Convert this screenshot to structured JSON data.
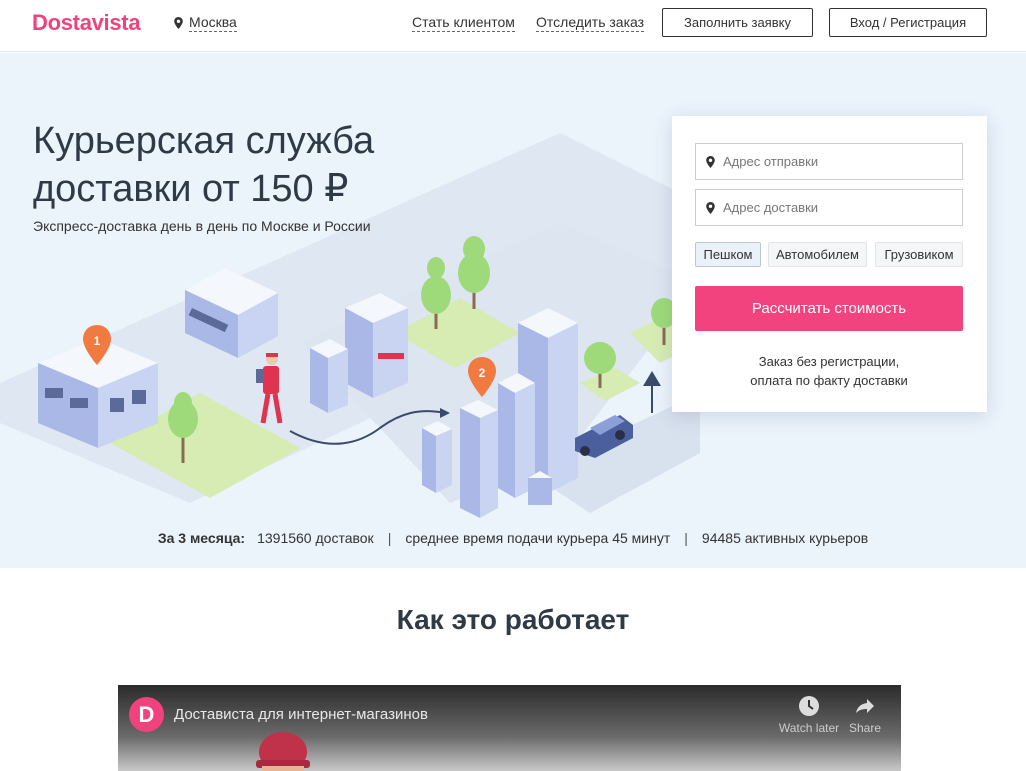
{
  "header": {
    "logo": "Dostavista",
    "city": "Москва",
    "nav": [
      "Стать клиентом",
      "Отследить заказ"
    ],
    "order_button": "Заполнить заявку",
    "login_button": "Вход / Регистрация"
  },
  "hero": {
    "title": "Курьерская служба доставки от 150 ₽",
    "subtitle": "Экспресс-доставка день в день по Москве и России",
    "markers": [
      "1",
      "2"
    ]
  },
  "form": {
    "from_placeholder": "Адрес отправки",
    "to_placeholder": "Адрес доставки",
    "transport": [
      "Пешком",
      "Автомобилем",
      "Грузовиком"
    ],
    "selected_transport": "Пешком",
    "submit": "Рассчитать стоимость",
    "note": [
      "Заказ без регистрации,",
      "оплата по факту доставки"
    ]
  },
  "stats": {
    "label": "За 3 месяца:",
    "deliveries": "1391560 доставок",
    "avg_time": "среднее время подачи курьера 45 минут",
    "couriers": "94485 активных курьеров"
  },
  "how": {
    "title": "Как это работает"
  },
  "video": {
    "avatar_letter": "D",
    "title": "Достависта для интернет-магазинов",
    "watch_later": "Watch later",
    "share": "Share"
  },
  "colors": {
    "brand": "#f0437e",
    "hero_bg": "#ebf3fb",
    "text": "#2f3a47"
  },
  "icons": [
    "map-pin-icon",
    "clock-icon",
    "share-arrow-icon"
  ]
}
